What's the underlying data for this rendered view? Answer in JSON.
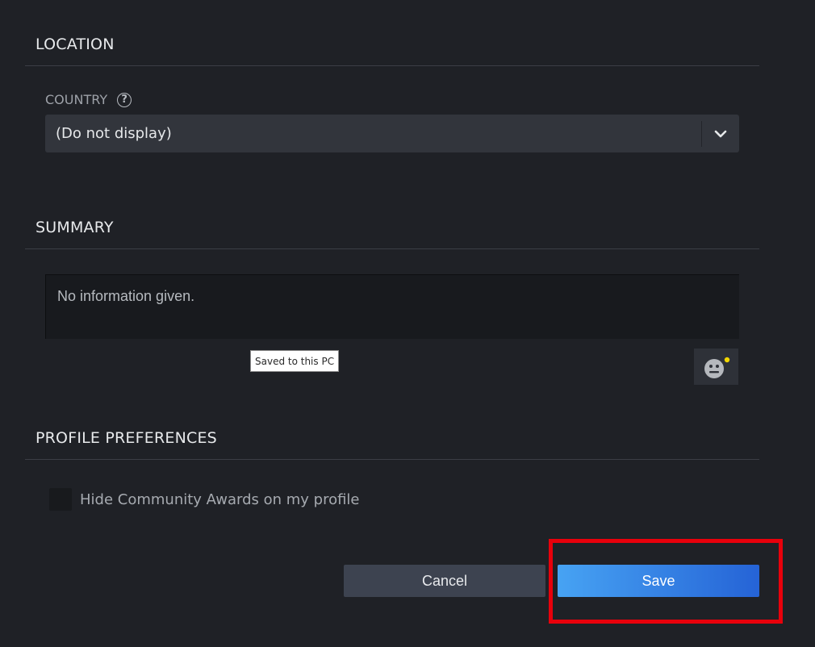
{
  "location": {
    "title": "LOCATION",
    "country_label": "COUNTRY",
    "help_glyph": "?",
    "country_value": "(Do not display)"
  },
  "summary": {
    "title": "SUMMARY",
    "text": "No information given.",
    "tooltip": "Saved to this PC",
    "emoji_icon": "smiley-face-icon"
  },
  "preferences": {
    "title": "PROFILE PREFERENCES",
    "hide_awards_label": "Hide Community Awards on my profile",
    "hide_awards_checked": false
  },
  "actions": {
    "cancel_label": "Cancel",
    "save_label": "Save"
  },
  "colors": {
    "background": "#1f2126",
    "save_gradient_start": "#47a3f3",
    "save_gradient_end": "#2563d6",
    "highlight": "#e8000b",
    "notification_dot": "#f2d600"
  }
}
